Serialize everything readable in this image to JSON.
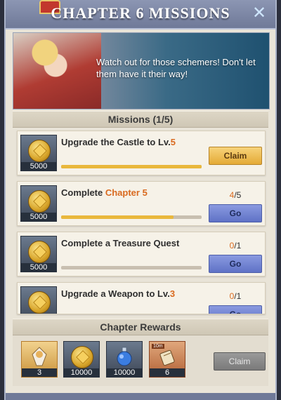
{
  "header": {
    "title": "CHAPTER 6 MISSIONS",
    "close_icon": "close-icon"
  },
  "banner": {
    "text": "Watch out for those schemers! Don't let them have it their way!"
  },
  "missions_header": "Missions (1/5)",
  "missions": [
    {
      "title_prefix": "Upgrade the Castle to Lv.",
      "title_highlight": "5",
      "reward_qty": "5000",
      "progress": 1.0,
      "action": "Claim"
    },
    {
      "title_prefix": "Complete ",
      "title_highlight": "Chapter 5",
      "reward_qty": "5000",
      "progress": 0.8,
      "count_current": "4",
      "count_total": "/5",
      "action": "Go"
    },
    {
      "title_prefix": "Complete a Treasure Quest",
      "title_highlight": "",
      "reward_qty": "5000",
      "progress": 0.0,
      "count_current": "0",
      "count_total": "/1",
      "action": "Go"
    },
    {
      "title_prefix": "Upgrade a Weapon to Lv.",
      "title_highlight": "3",
      "reward_qty": "",
      "progress": 0.0,
      "count_current": "0",
      "count_total": "/1",
      "action": "Go"
    }
  ],
  "rewards_header": "Chapter Rewards",
  "rewards": [
    {
      "qty": "3",
      "icon": "hero-shard-icon"
    },
    {
      "qty": "10000",
      "icon": "gold-coin-icon"
    },
    {
      "qty": "10000",
      "icon": "potion-icon"
    },
    {
      "qty": "6",
      "icon": "scroll-icon",
      "tag": "10m"
    }
  ],
  "rewards_claim_label": "Claim",
  "colors": {
    "highlight": "#d96a1f",
    "go_button": "#6f82d4",
    "claim_button": "#efc45a",
    "progress": "#e9b83c"
  }
}
